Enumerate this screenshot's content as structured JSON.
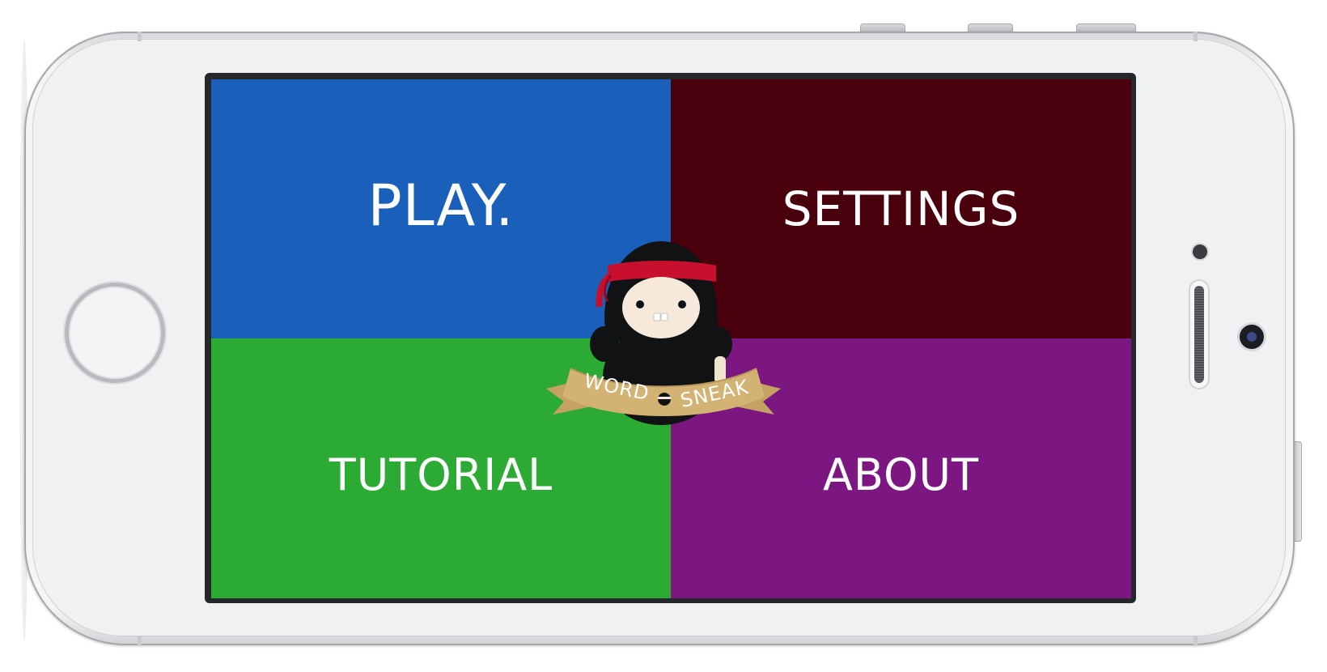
{
  "app": {
    "name": "Word Sneak"
  },
  "menu": {
    "play_label": "PLAY.",
    "settings_label": "SETTINGS",
    "tutorial_label": "TUTORIAL",
    "about_label": "ABOUT"
  },
  "logo": {
    "banner_word_left": "WORD",
    "banner_word_right": "SNEAK",
    "icon": "ninja-mascot-icon"
  },
  "colors": {
    "play_tile": "#1a5fba",
    "settings_tile": "#4a000c",
    "tutorial_tile": "#2baa34",
    "about_tile": "#7c1782",
    "headband": "#c8102e",
    "banner": "#d2b373"
  },
  "device": {
    "home_button_icon": "home-button-icon",
    "camera_icon": "front-camera-icon",
    "speaker_icon": "earpiece-speaker-icon"
  }
}
